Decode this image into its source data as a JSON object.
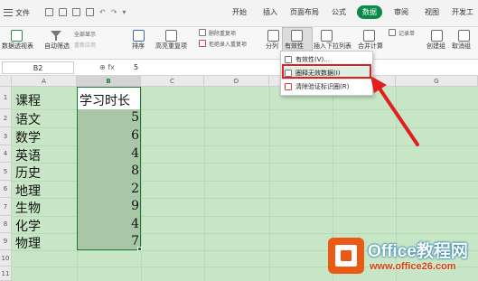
{
  "menubar": {
    "file_label": "文件",
    "tabs": [
      "开始",
      "插入",
      "页面布局",
      "公式",
      "数据",
      "审阅",
      "视图",
      "开发工"
    ],
    "active_tab": "数据"
  },
  "ribbon": {
    "pivot": "数据透视表",
    "autofilter": "自动筛选",
    "show_all": "全部显示",
    "reapply": "重新应用",
    "sort": "排序",
    "highlight_dup": "高亮重复项",
    "delete_dup": "删除重复项",
    "reject_dup": "拒绝录入重复项",
    "split": "分列",
    "validity": "有效性",
    "insert_dropdown": "插入下拉列表",
    "consolidate": "合并计算",
    "record": "记录单",
    "create_group": "创建组",
    "ungroup": "取消组"
  },
  "formula_bar": {
    "name_box": "B2",
    "fx": "fx",
    "value": "5"
  },
  "dropdown": {
    "items": [
      "有效性(V)...",
      "圈释无效数据(I)",
      "清除验证标识圈(R)"
    ]
  },
  "sheet": {
    "columns": [
      "A",
      "B",
      "C",
      "D",
      "E",
      "F",
      "G"
    ],
    "rows": [
      "1",
      "2",
      "3",
      "4",
      "5",
      "6",
      "7",
      "8",
      "9",
      "10",
      "11"
    ],
    "header": {
      "course": "课程",
      "study_time": "学习时长"
    },
    "data": [
      {
        "course": "语文",
        "hours": "5"
      },
      {
        "course": "数学",
        "hours": "6"
      },
      {
        "course": "英语",
        "hours": "4"
      },
      {
        "course": "历史",
        "hours": "8"
      },
      {
        "course": "地理",
        "hours": "2"
      },
      {
        "course": "生物",
        "hours": "9"
      },
      {
        "course": "化学",
        "hours": "4"
      },
      {
        "course": "物理",
        "hours": "7"
      }
    ]
  },
  "watermark": {
    "title": "Office教程网",
    "url": "www.office26.com"
  },
  "colors": {
    "accent_green": "#0a8a4a",
    "sheet_bg": "#c7e6c5",
    "highlight_red": "#e21f1f"
  }
}
